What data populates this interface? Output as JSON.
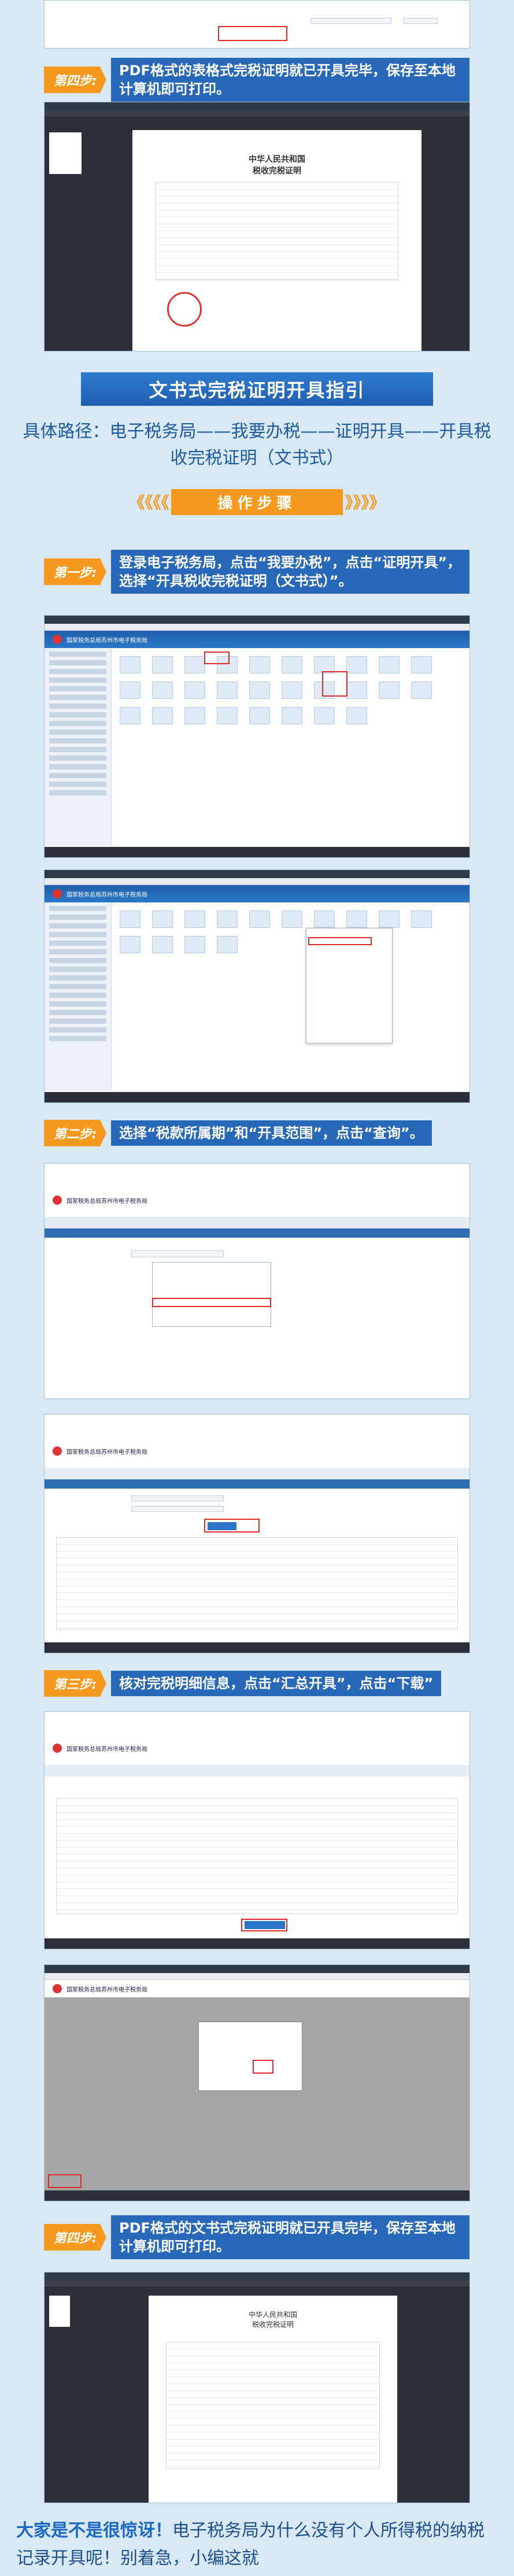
{
  "step4_top": {
    "badge": "第四步:",
    "text": "PDF格式的表格式完税证明就已开具完毕，保存至本地计算机即可打印。"
  },
  "pdf_top": {
    "title1": "中华人民共和国",
    "title2": "税收完税证明"
  },
  "section": {
    "title": "文书式完税证明开具指引",
    "path": "具体路径：电子税务局——我要办税——证明开具——开具税收完税证明（文书式）"
  },
  "ops": {
    "label": "操作步骤",
    "chev_left": "《《《《",
    "chev_right": "》》》》"
  },
  "steps": [
    {
      "badge": "第一步:",
      "text": "登录电子税务局，点击“我要办税”，点击“证明开具”，选择“开具税收完税证明（文书式）”。"
    },
    {
      "badge": "第二步:",
      "text": "选择“税款所属期”和“开具范围”，点击“查询”。"
    },
    {
      "badge": "第三步:",
      "text": "核对完税明细信息，点击“汇总开具”，点击“下载”"
    },
    {
      "badge": "第四步:",
      "text": "PDF格式的文书式完税证明就已开具完毕，保存至本地计算机即可打印。"
    }
  ],
  "site_title": "国家税务总局苏州市电子税务局",
  "bottom_text": {
    "bold": "大家是不是很惊讶！",
    "rest": "电子税务局为什么没有个人所得税的纳税记录开具呢！别着急，小编这就"
  }
}
